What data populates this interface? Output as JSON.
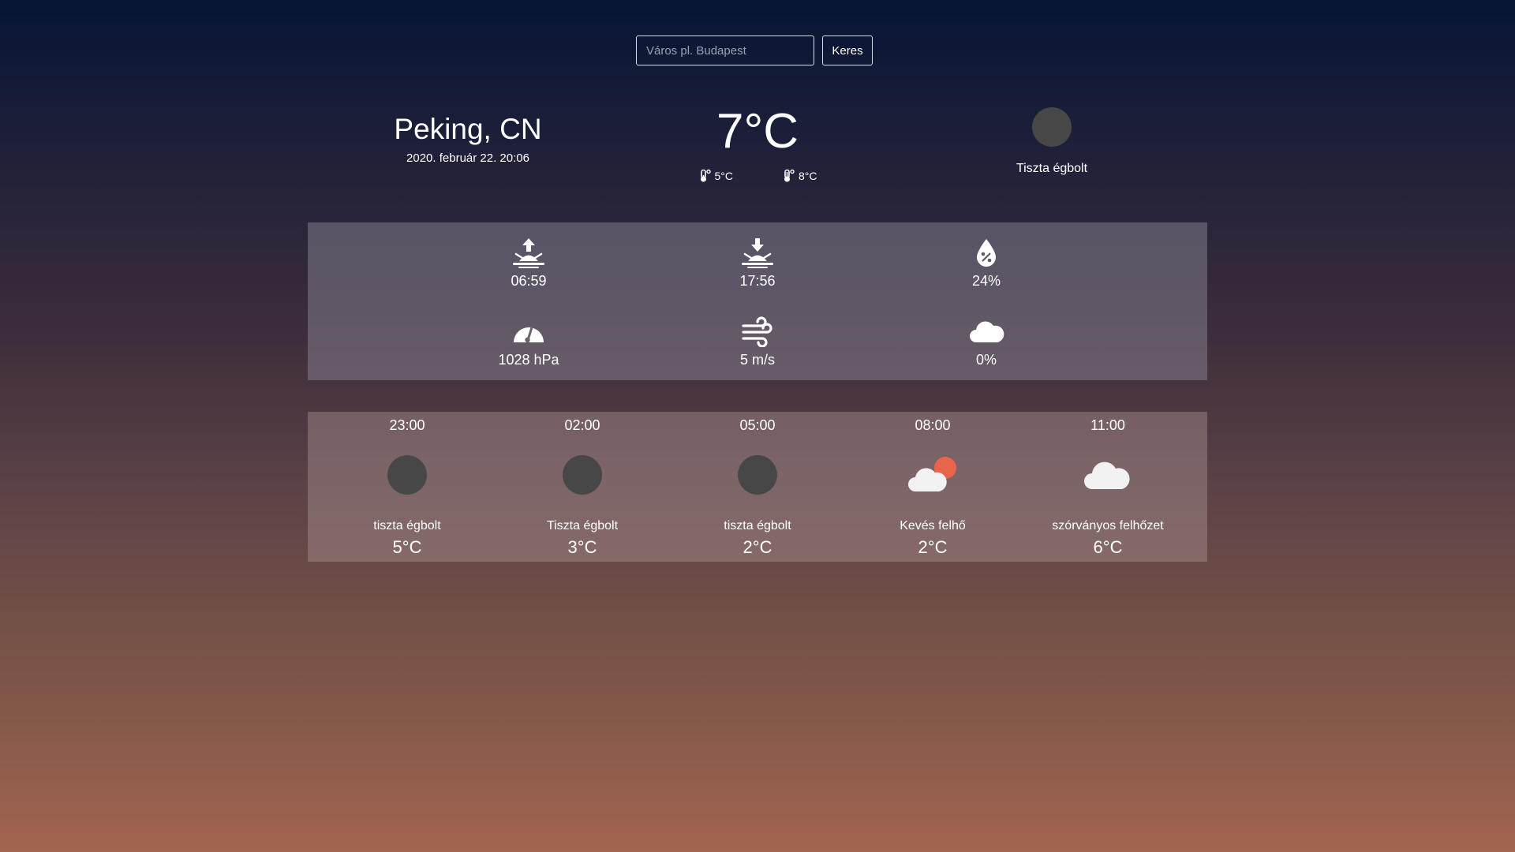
{
  "search": {
    "placeholder": "Város pl. Budapest",
    "button_label": "Keres"
  },
  "current": {
    "city": "Peking, CN",
    "datetime": "2020. február 22. 20:06",
    "temp": "7°C",
    "temp_min": "5°C",
    "temp_max": "8°C",
    "condition": "Tiszta égbolt",
    "condition_icon": "moon-icon"
  },
  "details": {
    "sunrise": "06:59",
    "sunset": "17:56",
    "humidity": "24%",
    "pressure": "1028 hPa",
    "wind": "5 m/s",
    "clouds": "0%"
  },
  "forecast": [
    {
      "time": "23:00",
      "desc": "tiszta égbolt",
      "temp": "5°C",
      "icon": "moon-icon"
    },
    {
      "time": "02:00",
      "desc": "Tiszta égbolt",
      "temp": "3°C",
      "icon": "moon-icon"
    },
    {
      "time": "05:00",
      "desc": "tiszta égbolt",
      "temp": "2°C",
      "icon": "moon-icon"
    },
    {
      "time": "08:00",
      "desc": "Kevés felhő",
      "temp": "2°C",
      "icon": "cloud-sun-icon"
    },
    {
      "time": "11:00",
      "desc": "szórványos felhőzet",
      "temp": "6°C",
      "icon": "cloud-icon"
    }
  ],
  "colors": {
    "moon": "#474747",
    "sun": "#e8654a",
    "icon_white": "#ffffff"
  }
}
